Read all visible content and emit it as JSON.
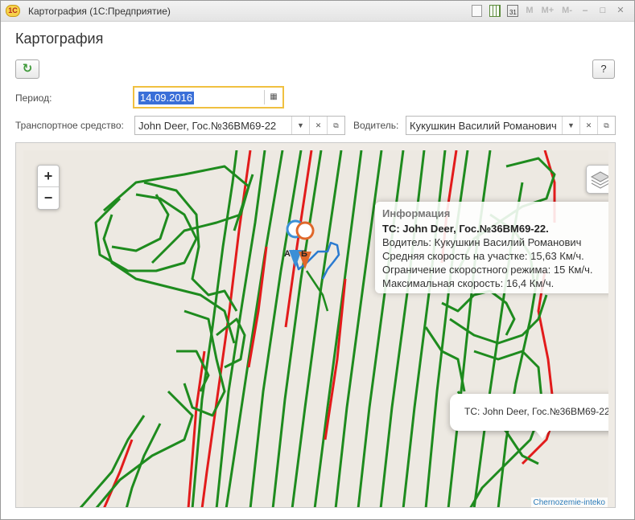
{
  "window": {
    "title": "Картография  (1С:Предприятие)"
  },
  "titlebar_icons": {
    "app_logo_text": "1С",
    "calendar_text": "31",
    "m": "M",
    "m_plus": "M+",
    "m_minus": "M-",
    "minimize": "–",
    "maximize": "□",
    "close": "✕"
  },
  "page": {
    "title": "Картография"
  },
  "toolbar": {
    "refresh_glyph": "↻",
    "help_label": "?"
  },
  "filters": {
    "period_label": "Период:",
    "period_value": "14.09.2016",
    "vehicle_label": "Транспортное средство:",
    "vehicle_value": "John Deer, Гос.№36ВМ69-22",
    "driver_label": "Водитель:",
    "driver_value": "Кукушкин Василий Романович"
  },
  "map": {
    "zoom_in": "+",
    "zoom_out": "−",
    "marker_a": "А",
    "marker_b": "Б",
    "info": {
      "heading": "Информация",
      "vehicle": "ТС: John Deer, Гос.№36ВМ69-22.",
      "driver": "Водитель: Кукушкин Василий Романович",
      "avg_speed": "Средняя скорость на участке: 15,63 Км/ч.",
      "speed_limit": "Ограничение скоростного режима: 15 Км/ч.",
      "max_speed": "Максимальная скорость: 16,4 Км/ч."
    },
    "popup": {
      "text": "ТС: John Deer, Гос.№36ВМ69-22.",
      "close": "×"
    },
    "attribution": "Chernozemie-inteko",
    "colors": {
      "track_green": "#1e8b1e",
      "track_red": "#e21b1b",
      "track_blue": "#2a7ad0",
      "marker_orange": "#e0672a",
      "marker_blue": "#3b8fd6"
    }
  }
}
